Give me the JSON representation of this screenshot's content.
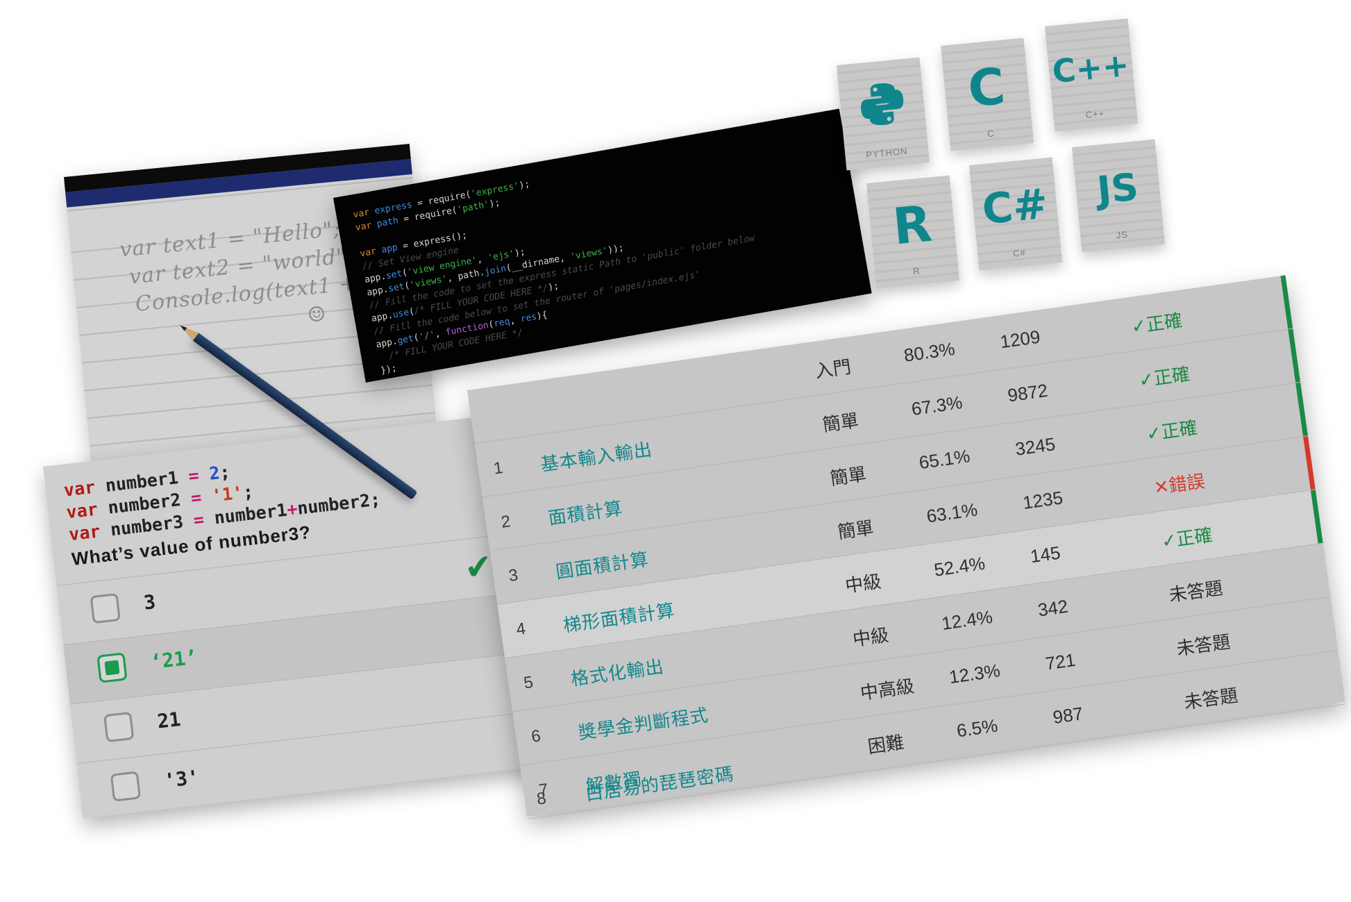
{
  "notebook": {
    "lines": [
      "var text1 = \"Hello\";",
      "var text2 = \"world\";",
      "Console.log(text1 + text2",
      "☺"
    ]
  },
  "code_editor": {
    "lines": [
      "var express = require('express');",
      "var path = require('path');",
      "",
      "var app = express();",
      "// Set View engine",
      "app.set('view engine', 'ejs');",
      "app.set('views', path.join(__dirname, 'views'));",
      "// Fill the code to set the express static Path to 'public' folder below",
      "/* FILL YOUR CODE HERE */",
      "app.use(",
      "// Fill the code below to set the router of 'pages/index.ejs'",
      "app.get('/', function(req, res){",
      "  /* FILL YOUR CODE HERE */",
      "});"
    ]
  },
  "quiz": {
    "code": [
      {
        "kw": "var",
        "name": " number1 ",
        "eq": "=",
        "val": " 2",
        "end": ";"
      },
      {
        "kw": "var",
        "name": " number2 ",
        "eq": "=",
        "val": " '1'",
        "end": ";"
      },
      {
        "kw": "var",
        "name": " number3 ",
        "eq": "=",
        "a": " number1",
        "op": "+",
        "b": "number2",
        "end": ";"
      }
    ],
    "question": "What’s value of number3?",
    "options": [
      {
        "label": "3",
        "selected": false
      },
      {
        "label": "‘21’",
        "selected": true
      },
      {
        "label": "21",
        "selected": false
      },
      {
        "label": "'3'",
        "selected": false
      }
    ],
    "check_icon": "check-icon"
  },
  "languages": [
    {
      "symbol": "",
      "caption": "PYTHON",
      "icon": "python-logo-icon"
    },
    {
      "symbol": "C",
      "caption": "C"
    },
    {
      "symbol": "C++",
      "caption": "C++"
    },
    {
      "symbol": "R",
      "caption": "R"
    },
    {
      "symbol": "C#",
      "caption": "C#"
    },
    {
      "symbol": "JS",
      "caption": "JS"
    }
  ],
  "problems": [
    {
      "num": "",
      "title": "",
      "level": "入門",
      "rate": "80.3%",
      "count": "1209",
      "status": "正確",
      "status_type": "ok"
    },
    {
      "num": "1",
      "title": "基本輸入輸出",
      "level": "簡單",
      "rate": "67.3%",
      "count": "9872",
      "status": "正確",
      "status_type": "ok"
    },
    {
      "num": "2",
      "title": "面積計算",
      "level": "簡單",
      "rate": "65.1%",
      "count": "3245",
      "status": "正確",
      "status_type": "ok"
    },
    {
      "num": "3",
      "title": "圓面積計算",
      "level": "簡單",
      "rate": "63.1%",
      "count": "1235",
      "status": "錯誤",
      "status_type": "bad"
    },
    {
      "num": "4",
      "title": "梯形面積計算",
      "level": "中級",
      "rate": "52.4%",
      "count": "145",
      "status": "正確",
      "status_type": "ok"
    },
    {
      "num": "5",
      "title": "格式化輸出",
      "level": "中級",
      "rate": "12.4%",
      "count": "342",
      "status": "未答題",
      "status_type": "none"
    },
    {
      "num": "6",
      "title": "獎學金判斷程式",
      "level": "中高級",
      "rate": "12.3%",
      "count": "721",
      "status": "未答題",
      "status_type": "none"
    },
    {
      "num": "7",
      "title": "解數獨",
      "level": "困難",
      "rate": "6.5%",
      "count": "987",
      "status": "未答題",
      "status_type": "none"
    },
    {
      "num": "8",
      "title": "白居易的琵琶密碼",
      "level": "",
      "rate": "",
      "count": "",
      "status": "",
      "status_type": "none"
    }
  ],
  "colors": {
    "accent": "#13878c",
    "correct": "#1a8a44",
    "wrong": "#d33a2c"
  }
}
